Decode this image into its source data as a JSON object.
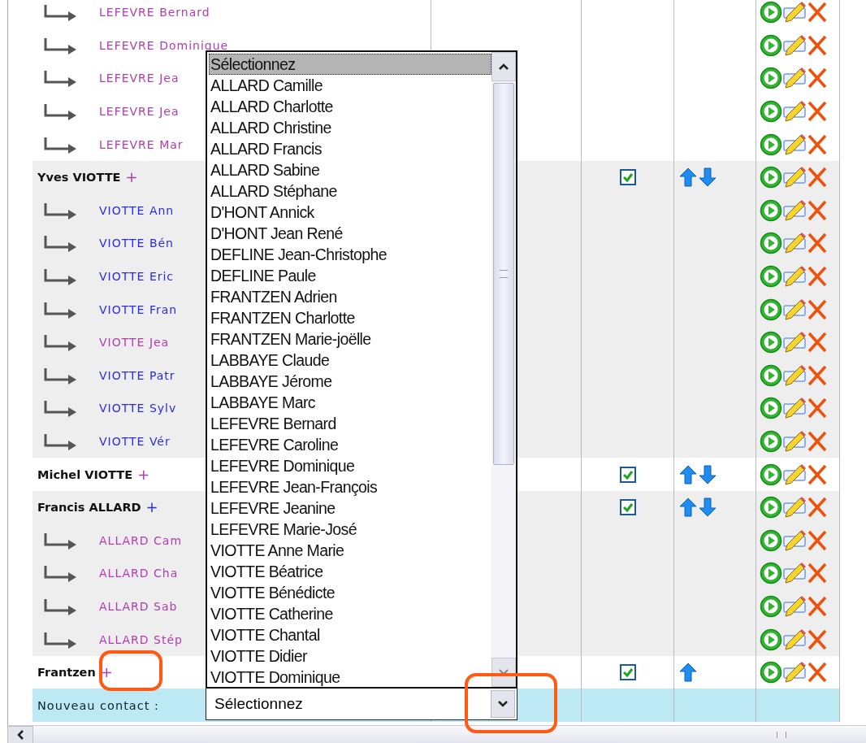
{
  "rows": [
    {
      "kind": "sub",
      "name": "LEFEVRE Bernard",
      "color": "#b23cb2",
      "shaded": false
    },
    {
      "kind": "sub",
      "name": "LEFEVRE Dominique",
      "color": "#b23cb2",
      "shaded": false
    },
    {
      "kind": "sub",
      "name": "LEFEVRE Jea",
      "color": "#b23cb2",
      "shaded": false
    },
    {
      "kind": "sub",
      "name": "LEFEVRE Jea",
      "color": "#b23cb2",
      "shaded": false
    },
    {
      "kind": "sub",
      "name": "LEFEVRE Mar",
      "color": "#b23cb2",
      "shaded": false
    },
    {
      "kind": "contact",
      "name": "Yves VIOTTE",
      "add": "+",
      "color": "#b23cb2",
      "shaded": true,
      "checked": true,
      "move_up": true,
      "move_down": true
    },
    {
      "kind": "sub",
      "name": "VIOTTE Ann",
      "color": "#2b2be6",
      "shaded": true
    },
    {
      "kind": "sub",
      "name": "VIOTTE Bén",
      "color": "#2b2be6",
      "shaded": true
    },
    {
      "kind": "sub",
      "name": "VIOTTE Eric",
      "color": "#2b2be6",
      "shaded": true
    },
    {
      "kind": "sub",
      "name": "VIOTTE Fran",
      "color": "#2b2be6",
      "shaded": true
    },
    {
      "kind": "sub",
      "name": "VIOTTE Jea",
      "color": "#b23cb2",
      "shaded": true
    },
    {
      "kind": "sub",
      "name": "VIOTTE Patr",
      "color": "#2b2be6",
      "shaded": true
    },
    {
      "kind": "sub",
      "name": "VIOTTE Sylv",
      "color": "#2b2be6",
      "shaded": true
    },
    {
      "kind": "sub",
      "name": "VIOTTE Vér",
      "color": "#2b2be6",
      "shaded": true
    },
    {
      "kind": "contact",
      "name": "Michel VIOTTE",
      "add": "+",
      "color": "#b23cb2",
      "shaded": false,
      "checked": true,
      "move_up": true,
      "move_down": true
    },
    {
      "kind": "contact",
      "name": "Francis ALLARD",
      "add": "+",
      "color": "#2b2be6",
      "shaded": true,
      "checked": true,
      "move_up": true,
      "move_down": true
    },
    {
      "kind": "sub",
      "name": "ALLARD Cam",
      "color": "#b23cb2",
      "shaded": true
    },
    {
      "kind": "sub",
      "name": "ALLARD Cha",
      "color": "#b23cb2",
      "shaded": true
    },
    {
      "kind": "sub",
      "name": "ALLARD Sab",
      "color": "#b23cb2",
      "shaded": true
    },
    {
      "kind": "sub",
      "name": "ALLARD Stép",
      "color": "#b23cb2",
      "shaded": true
    },
    {
      "kind": "contact",
      "name": "Frantzen",
      "add": "+",
      "color": "#b23cb2",
      "shaded": false,
      "checked": true,
      "move_up": true,
      "move_down": false
    }
  ],
  "new_contact": {
    "label": "Nouveau contact :",
    "value": "Sélectionnez",
    "expanded": true
  },
  "dropdown_options": [
    {
      "label": "Sélectionnez",
      "selected": true
    },
    {
      "label": "ALLARD Camille",
      "selected": false
    },
    {
      "label": "ALLARD Charlotte",
      "selected": false
    },
    {
      "label": "ALLARD Christine",
      "selected": false
    },
    {
      "label": "ALLARD Francis",
      "selected": false
    },
    {
      "label": "ALLARD Sabine",
      "selected": false
    },
    {
      "label": "ALLARD Stéphane",
      "selected": false
    },
    {
      "label": "D'HONT Annick",
      "selected": false
    },
    {
      "label": "D'HONT Jean René",
      "selected": false
    },
    {
      "label": "DEFLINE Jean-Christophe",
      "selected": false
    },
    {
      "label": "DEFLINE Paule",
      "selected": false
    },
    {
      "label": "FRANTZEN Adrien",
      "selected": false
    },
    {
      "label": "FRANTZEN Charlotte",
      "selected": false
    },
    {
      "label": "FRANTZEN Marie-joëlle",
      "selected": false
    },
    {
      "label": "LABBAYE Claude",
      "selected": false
    },
    {
      "label": "LABBAYE Jérome",
      "selected": false
    },
    {
      "label": "LABBAYE Marc",
      "selected": false
    },
    {
      "label": "LEFEVRE Bernard",
      "selected": false
    },
    {
      "label": "LEFEVRE Caroline",
      "selected": false
    },
    {
      "label": "LEFEVRE Dominique",
      "selected": false
    },
    {
      "label": "LEFEVRE Jean-François",
      "selected": false
    },
    {
      "label": "LEFEVRE Jeanine",
      "selected": false
    },
    {
      "label": "LEFEVRE Marie-José",
      "selected": false
    },
    {
      "label": "VIOTTE Anne Marie",
      "selected": false
    },
    {
      "label": "VIOTTE Béatrice",
      "selected": false
    },
    {
      "label": "VIOTTE Bénédicte",
      "selected": false
    },
    {
      "label": "VIOTTE Catherine",
      "selected": false
    },
    {
      "label": "VIOTTE Chantal",
      "selected": false
    },
    {
      "label": "VIOTTE Didier",
      "selected": false
    },
    {
      "label": "VIOTTE Dominique",
      "selected": false
    }
  ],
  "annotations": [
    {
      "kind": "circle"
    },
    {
      "kind": "circle"
    }
  ]
}
